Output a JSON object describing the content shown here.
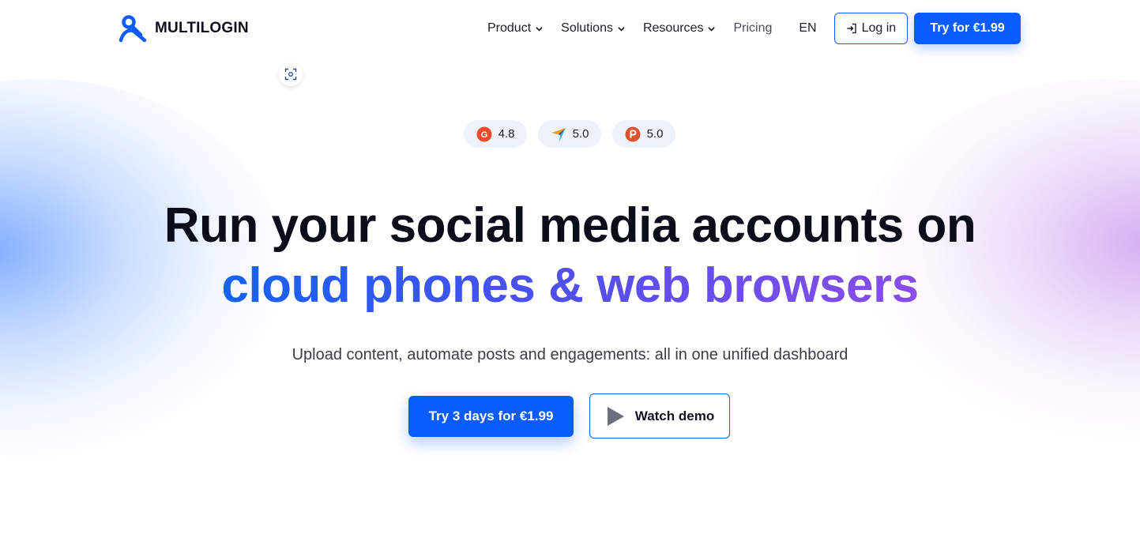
{
  "brand": {
    "name": "MULTILOGIN",
    "color": "#0b5cff"
  },
  "nav": {
    "items": [
      {
        "label": "Product",
        "dropdown": true
      },
      {
        "label": "Solutions",
        "dropdown": true
      },
      {
        "label": "Resources",
        "dropdown": true
      },
      {
        "label": "Pricing",
        "dropdown": false
      }
    ],
    "language": "EN",
    "login_label": "Log in",
    "try_label": "Try for €1.99"
  },
  "ratings": [
    {
      "icon": "g2-icon",
      "value": "4.8"
    },
    {
      "icon": "capterra-icon",
      "value": "5.0"
    },
    {
      "icon": "producthunt-icon",
      "value": "5.0"
    }
  ],
  "hero": {
    "headline_line1": "Run your social media accounts on",
    "headline_line2": "cloud phones & web browsers",
    "subtitle": "Upload content, automate posts and engagements: all in one unified dashboard",
    "primary_cta": "Try 3 days for €1.99",
    "secondary_cta": "Watch demo"
  },
  "colors": {
    "accent": "#0b5cff",
    "gradient_start": "#1463f3",
    "gradient_end": "#8a4de8"
  }
}
